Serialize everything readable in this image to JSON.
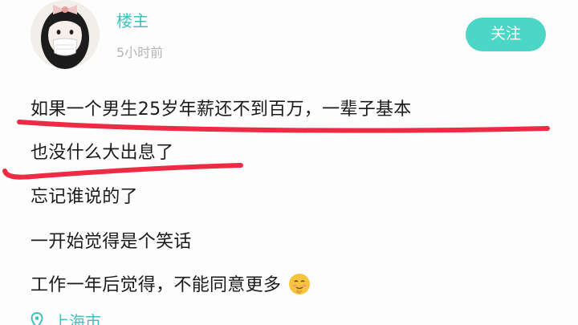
{
  "header": {
    "username": "楼主",
    "timestamp": "5小时前",
    "follow_label": "关注"
  },
  "post": {
    "lines": [
      "如果一个男生25岁年薪还不到百万，一辈子基本",
      "也没什么大出息了",
      "忘记谁说的了",
      "一开始觉得是个笑话",
      "工作一年后觉得，不能同意更多"
    ],
    "emoji": "grinning-blush-face-icon"
  },
  "location": {
    "text": "上海市",
    "icon": "location-pin-icon"
  },
  "colors": {
    "accent": "#3fc1bd",
    "follow_button": "#4bd6c6",
    "annotation_stroke": "#ee2b45",
    "text": "#1a1a1a",
    "muted": "#b5b5b5"
  }
}
